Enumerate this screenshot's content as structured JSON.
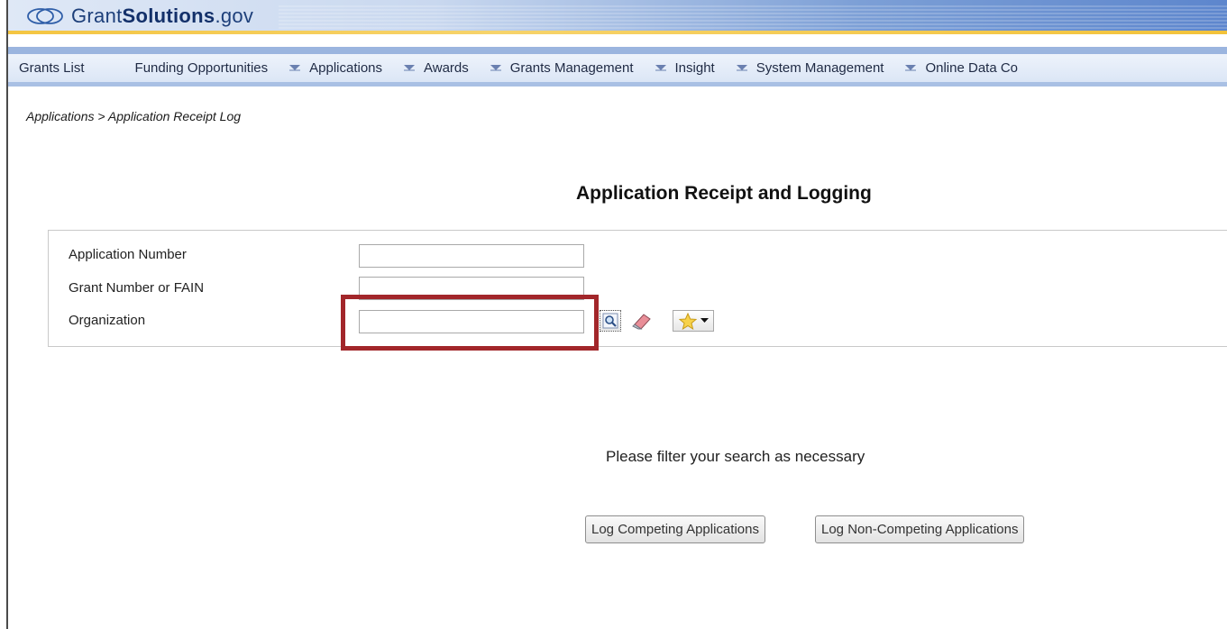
{
  "header": {
    "logo_prefix": "Grant",
    "logo_bold": "Solutions",
    "logo_suffix": ".gov"
  },
  "menu": {
    "items": [
      {
        "label": "Grants List",
        "has_caret": false
      },
      {
        "label": "Funding Opportunities",
        "has_caret": true
      },
      {
        "label": "Applications",
        "has_caret": true
      },
      {
        "label": "Awards",
        "has_caret": true
      },
      {
        "label": "Grants Management",
        "has_caret": true
      },
      {
        "label": "Insight",
        "has_caret": true
      },
      {
        "label": "System Management",
        "has_caret": true
      },
      {
        "label": "Online Data Co",
        "has_caret": false
      }
    ],
    "caret_icon": "triangle-down-icon"
  },
  "breadcrumb": "Applications > Application Receipt Log",
  "page_title": "Application Receipt and Logging",
  "filters": {
    "application_number": {
      "label": "Application Number",
      "value": ""
    },
    "grant_number": {
      "label": "Grant Number or FAIN",
      "value": ""
    },
    "organization": {
      "label": "Organization",
      "value": ""
    },
    "icons": [
      "magnifier-icon",
      "eraser-icon",
      "star-icon",
      "dropdown-arrow-icon"
    ]
  },
  "message": "Please filter your search as necessary",
  "actions": {
    "log_competing": "Log Competing Applications",
    "log_non_competing": "Log Non-Competing Applications"
  },
  "colors": {
    "highlight_box": "#a2262a",
    "menu_bg": "#dbe6f6",
    "banner_gold": "#f4c542",
    "logo_text": "#1d3f7a"
  }
}
